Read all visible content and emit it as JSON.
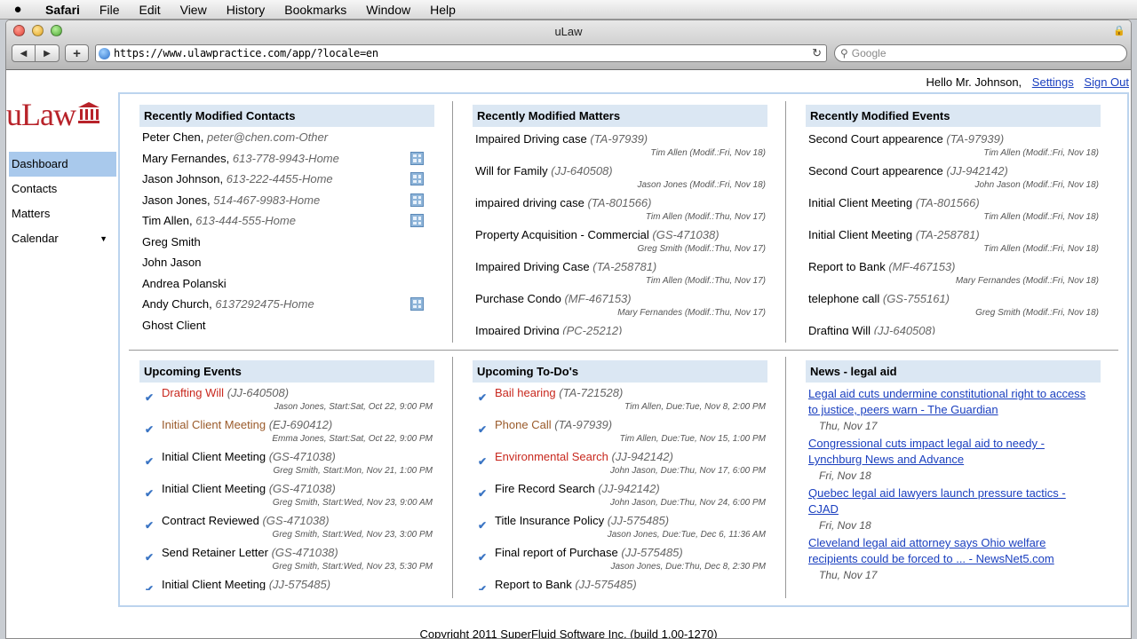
{
  "menubar": {
    "apple": "",
    "items": [
      "Safari",
      "File",
      "Edit",
      "View",
      "History",
      "Bookmarks",
      "Window",
      "Help"
    ]
  },
  "window": {
    "title": "uLaw",
    "url": "https://www.ulawpractice.com/app/?locale=en",
    "search_placeholder": "Google"
  },
  "header": {
    "greeting": "Hello Mr. Johnson,",
    "settings": "Settings",
    "signout": "Sign Out",
    "logo": "uLaw"
  },
  "sidebar": {
    "items": [
      "Dashboard",
      "Contacts",
      "Matters",
      "Calendar"
    ],
    "active": "Dashboard"
  },
  "contacts": {
    "title": "Recently Modified Contacts",
    "items": [
      {
        "name": "Peter Chen",
        "detail": "peter@chen.com-Other",
        "vcard": false
      },
      {
        "name": "Mary Fernandes",
        "detail": "613-778-9943-Home",
        "vcard": true
      },
      {
        "name": "Jason Johnson",
        "detail": "613-222-4455-Home",
        "vcard": true
      },
      {
        "name": "Jason Jones",
        "detail": "514-467-9983-Home",
        "vcard": true
      },
      {
        "name": "Tim Allen",
        "detail": "613-444-555-Home",
        "vcard": true
      },
      {
        "name": "Greg Smith",
        "detail": "",
        "vcard": false
      },
      {
        "name": "John Jason",
        "detail": "",
        "vcard": false
      },
      {
        "name": "Andrea Polanski",
        "detail": "",
        "vcard": false
      },
      {
        "name": "Andy Church",
        "detail": "6137292475-Home",
        "vcard": true
      },
      {
        "name": "Ghost Client",
        "detail": "",
        "vcard": false
      }
    ]
  },
  "matters": {
    "title": "Recently Modified Matters",
    "items": [
      {
        "name": "Impaired Driving case",
        "code": "(TA-97939)",
        "meta": "Tim Allen (Modif.:Fri, Nov 18)"
      },
      {
        "name": "Will for Family",
        "code": "(JJ-640508)",
        "meta": "Jason Jones (Modif.:Fri, Nov 18)"
      },
      {
        "name": "impaired driving case",
        "code": "(TA-801566)",
        "meta": "Tim Allen (Modif.:Thu, Nov 17)"
      },
      {
        "name": "Property Acquisition - Commercial",
        "code": "(GS-471038)",
        "meta": "Greg Smith (Modif.:Thu, Nov 17)"
      },
      {
        "name": "Impaired Driving Case",
        "code": "(TA-258781)",
        "meta": "Tim Allen (Modif.:Thu, Nov 17)"
      },
      {
        "name": "Purchase Condo",
        "code": "(MF-467153)",
        "meta": "Mary Fernandes (Modif.:Thu, Nov 17)"
      },
      {
        "name": "Impaired Driving",
        "code": "(PC-25212)",
        "meta": ""
      }
    ]
  },
  "events": {
    "title": "Recently Modified Events",
    "items": [
      {
        "name": "Second Court appearence",
        "code": "(TA-97939)",
        "meta": "Tim Allen (Modif.:Fri, Nov 18)"
      },
      {
        "name": "Second Court appearence",
        "code": "(JJ-942142)",
        "meta": "John Jason (Modif.:Fri, Nov 18)"
      },
      {
        "name": "Initial Client Meeting",
        "code": "(TA-801566)",
        "meta": "Tim Allen (Modif.:Fri, Nov 18)"
      },
      {
        "name": "Initial Client Meeting",
        "code": "(TA-258781)",
        "meta": "Tim Allen (Modif.:Fri, Nov 18)"
      },
      {
        "name": "Report to Bank",
        "code": "(MF-467153)",
        "meta": "Mary Fernandes (Modif.:Fri, Nov 18)"
      },
      {
        "name": "telephone call",
        "code": "(GS-755161)",
        "meta": "Greg Smith (Modif.:Fri, Nov 18)"
      },
      {
        "name": "Drafting Will",
        "code": "(JJ-640508)",
        "meta": ""
      }
    ]
  },
  "upcoming_events": {
    "title": "Upcoming Events",
    "items": [
      {
        "name": "Drafting Will",
        "code": "(JJ-640508)",
        "meta": "Jason Jones, Start:Sat, Oct 22, 9:00 PM",
        "color": "red"
      },
      {
        "name": "Initial Client Meeting",
        "code": "(EJ-690412)",
        "meta": "Emma Jones, Start:Sat, Oct 22, 9:00 PM",
        "color": "brown"
      },
      {
        "name": "Initial Client Meeting",
        "code": "(GS-471038)",
        "meta": "Greg Smith, Start:Mon, Nov 21, 1:00 PM",
        "color": ""
      },
      {
        "name": "Initial Client Meeting",
        "code": "(GS-471038)",
        "meta": "Greg Smith, Start:Wed, Nov 23, 9:00 AM",
        "color": ""
      },
      {
        "name": "Contract Reviewed",
        "code": "(GS-471038)",
        "meta": "Greg Smith, Start:Wed, Nov 23, 3:00 PM",
        "color": ""
      },
      {
        "name": "Send Retainer Letter",
        "code": "(GS-471038)",
        "meta": "Greg Smith, Start:Wed, Nov 23, 5:30 PM",
        "color": ""
      },
      {
        "name": "Initial Client Meeting",
        "code": "(JJ-575485)",
        "meta": "",
        "color": ""
      }
    ]
  },
  "todos": {
    "title": "Upcoming To-Do's",
    "items": [
      {
        "name": "Bail hearing",
        "code": "(TA-721528)",
        "meta": "Tim Allen, Due:Tue, Nov 8, 2:00 PM",
        "color": "red"
      },
      {
        "name": "Phone Call",
        "code": "(TA-97939)",
        "meta": "Tim Allen, Due:Tue, Nov 15, 1:00 PM",
        "color": "brown"
      },
      {
        "name": "Environmental Search",
        "code": "(JJ-942142)",
        "meta": "John Jason, Due:Thu, Nov 17, 6:00 PM",
        "color": "red"
      },
      {
        "name": "Fire Record Search",
        "code": "(JJ-942142)",
        "meta": "John Jason, Due:Thu, Nov 24, 6:00 PM",
        "color": ""
      },
      {
        "name": "Title Insurance Policy",
        "code": "(JJ-575485)",
        "meta": "Jason Jones, Due:Tue, Dec 6, 11:36 AM",
        "color": ""
      },
      {
        "name": "Final report of Purchase",
        "code": "(JJ-575485)",
        "meta": "Jason Jones, Due:Thu, Dec 8, 2:30 PM",
        "color": ""
      },
      {
        "name": "Report to Bank",
        "code": "(JJ-575485)",
        "meta": "",
        "color": ""
      }
    ]
  },
  "news": {
    "title": "News - legal aid",
    "items": [
      {
        "line1": "Legal aid cuts undermine constitutional right to access",
        "line2": "to justice, peers warn - The Guardian",
        "date": "Thu, Nov 17"
      },
      {
        "line1": "Congressional cuts impact legal aid to needy -",
        "line2": "Lynchburg News and Advance",
        "date": "Fri, Nov 18"
      },
      {
        "line1": "Quebec legal aid lawyers launch pressure tactics -",
        "line2": "CJAD",
        "date": "Fri, Nov 18"
      },
      {
        "line1": "Cleveland legal aid attorney says Ohio welfare",
        "line2": "recipients could be forced to ... - NewsNet5.com",
        "date": "Thu, Nov 17"
      }
    ]
  },
  "footer": "Copyright 2011 SuperFluid Software Inc. (build 1.00-1270)"
}
